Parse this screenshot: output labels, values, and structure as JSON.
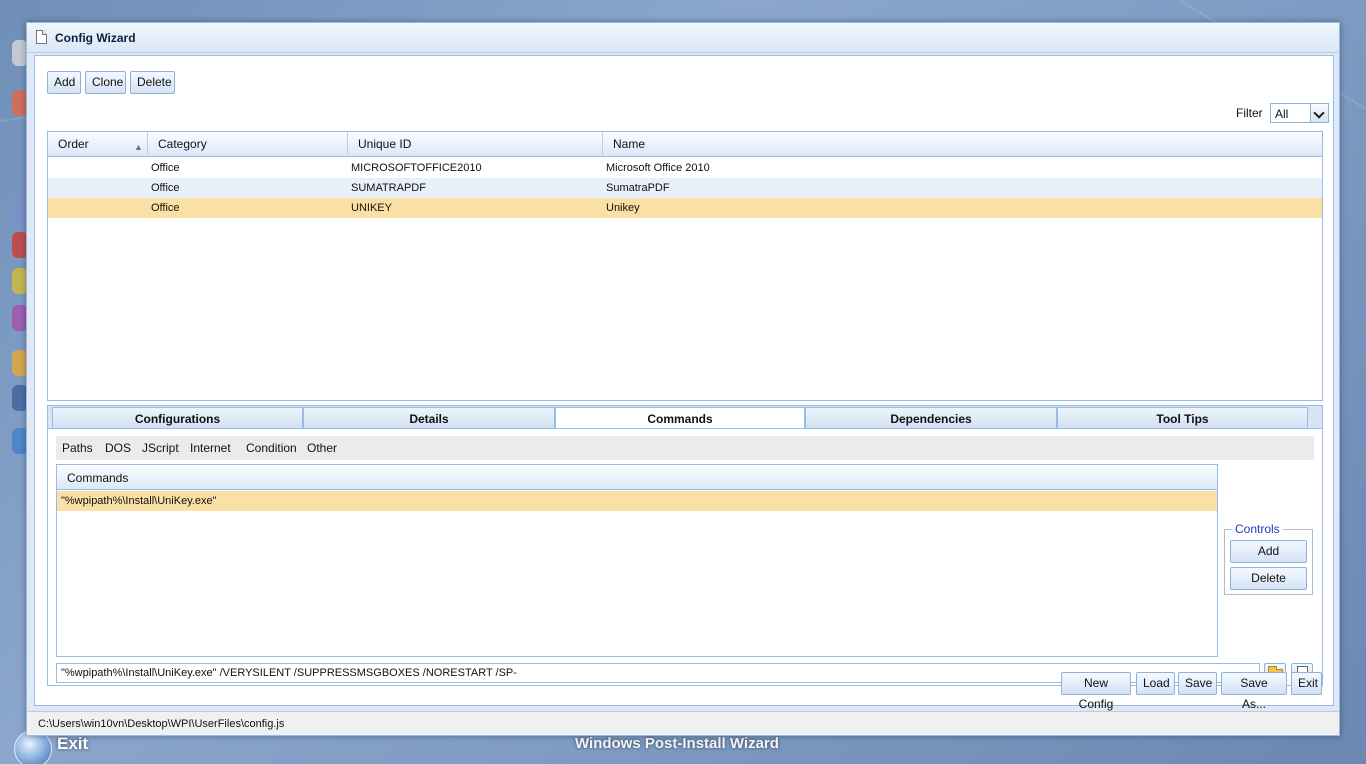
{
  "desktop": {
    "bottom_exit_label": "Exit",
    "bottom_title": "Windows Post-Install Wizard"
  },
  "window": {
    "title": "Config Wizard"
  },
  "toolbar": {
    "add_label": "Add",
    "clone_label": "Clone",
    "delete_label": "Delete",
    "filter_label": "Filter",
    "filter_value": "All"
  },
  "grid": {
    "columns": [
      "Order",
      "Category",
      "Unique ID",
      "Name"
    ],
    "rows": [
      {
        "order": "",
        "category": "Office",
        "unique_id": "MICROSOFTOFFICE2010",
        "name": "Microsoft Office 2010",
        "selected": false
      },
      {
        "order": "",
        "category": "Office",
        "unique_id": "SUMATRAPDF",
        "name": "SumatraPDF",
        "selected": false
      },
      {
        "order": "",
        "category": "Office",
        "unique_id": "UNIKEY",
        "name": "Unikey",
        "selected": true
      }
    ]
  },
  "tabs": [
    {
      "label": "Configurations",
      "active": false
    },
    {
      "label": "Details",
      "active": false
    },
    {
      "label": "Commands",
      "active": true
    },
    {
      "label": "Dependencies",
      "active": false
    },
    {
      "label": "Tool Tips",
      "active": false
    }
  ],
  "subtabs": [
    "Paths",
    "DOS",
    "JScript",
    "Internet",
    "Condition",
    "Other"
  ],
  "commands": {
    "header": "Commands",
    "rows": [
      "\"%wpipath%\\Install\\UniKey.exe\""
    ],
    "input_value": "\"%wpipath%\\Install\\UniKey.exe\" /VERYSILENT /SUPPRESSMSGBOXES /NORESTART /SP-"
  },
  "controls": {
    "legend": "Controls",
    "add_label": "Add",
    "delete_label": "Delete"
  },
  "footer": {
    "new_config_label": "New Config",
    "load_label": "Load",
    "save_label": "Save",
    "save_as_label": "Save As...",
    "exit_label": "Exit"
  },
  "status": {
    "path": "C:\\Users\\win10vn\\Desktop\\WPI\\UserFiles\\config.js"
  },
  "colors": {
    "selected_row": "#fbe0a6",
    "alt_row": "#e8f1fb",
    "border": "#99bbe8",
    "controls_legend": "#1f3bbd"
  }
}
